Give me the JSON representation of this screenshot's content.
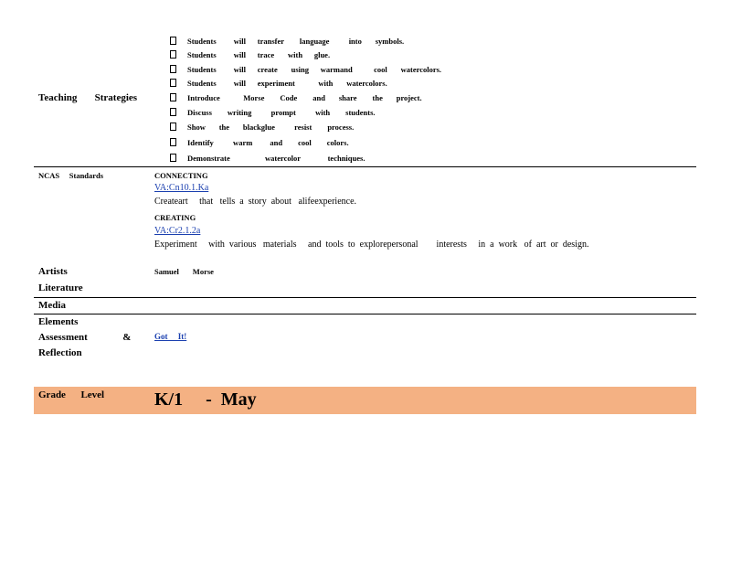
{
  "teaching": {
    "label": "Teaching       Strategies",
    "bullets": [
      "Students         will      transfer        language          into       symbols.",
      "Students         will      trace       with      glue.",
      "Students         will      create       using      warmand           cool       watercolors.",
      "Students         will      experiment            with       watercolors.",
      "Introduce            Morse        Code        and       share        the       project.",
      "Discuss        writing          prompt          with        students.",
      "Show       the       blackglue          resist        process.",
      "Identify          warm         and        cool        colors.",
      "Demonstrate                  watercolor              techniques."
    ]
  },
  "ncas": {
    "label": "NCAS     Standards",
    "connecting_heading": "CONNECTING",
    "connecting_link": "VA:Cn10.1.Ka",
    "connecting_text": "Createart     that   tells  a  story  about   alifeexperience.",
    "creating_heading": "CREATING",
    "creating_link": "VA:Cr2.1.2a",
    "creating_text": "Experiment     with  various   materials     and  tools  to  explorepersonal        interests     in  a  work   of  art  or  design."
  },
  "artists": {
    "label_line1": "Artists",
    "label_line2": "Literature",
    "value": "Samuel       Morse"
  },
  "media": {
    "label": "Media"
  },
  "assessment": {
    "label_line1": "Elements",
    "label_line2": "Assessment              &",
    "label_line3": "Reflection",
    "link": "Got     It!"
  },
  "grade": {
    "label": "Grade      Level",
    "value": "K/1     -  May",
    "band_color": "#f4b183"
  }
}
